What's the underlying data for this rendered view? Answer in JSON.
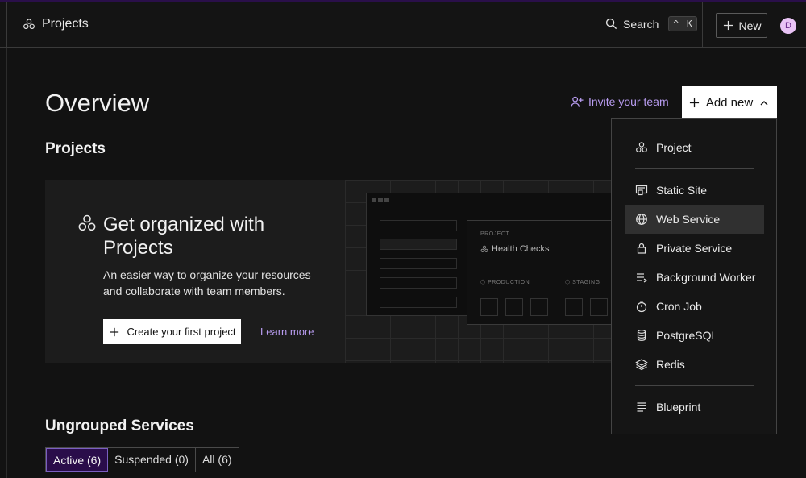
{
  "header": {
    "breadcrumb": "Projects",
    "search_label": "Search",
    "shortcut_modifier": "^",
    "shortcut_key": "K",
    "new_label": "New",
    "avatar_initial": "D"
  },
  "main": {
    "title": "Overview",
    "invite_label": "Invite your team",
    "add_new_label": "Add new",
    "projects_heading": "Projects",
    "promo": {
      "title": "Get organized with Projects",
      "description": "An easier way to organize your resources and collaborate with team members.",
      "create_label": "Create your first project",
      "learn_more_label": "Learn more",
      "mock": {
        "project_label": "PROJECT",
        "project_name": "Health Checks",
        "env_production": "PRODUCTION",
        "env_staging": "STAGING"
      }
    },
    "ungrouped_heading": "Ungrouped Services",
    "tabs": [
      {
        "label": "Active (6)",
        "active": true
      },
      {
        "label": "Suspended (0)",
        "active": false
      },
      {
        "label": "All (6)",
        "active": false
      }
    ]
  },
  "dropdown": {
    "items": [
      {
        "label": "Project",
        "icon": "project-icon"
      },
      {
        "label": "Static Site",
        "icon": "static-site-icon"
      },
      {
        "label": "Web Service",
        "icon": "globe-icon",
        "highlighted": true
      },
      {
        "label": "Private Service",
        "icon": "lock-icon"
      },
      {
        "label": "Background Worker",
        "icon": "worker-icon"
      },
      {
        "label": "Cron Job",
        "icon": "timer-icon"
      },
      {
        "label": "PostgreSQL",
        "icon": "database-icon"
      },
      {
        "label": "Redis",
        "icon": "layers-icon"
      },
      {
        "label": "Blueprint",
        "icon": "blueprint-icon"
      }
    ]
  },
  "colors": {
    "accent_link": "#b89cf0",
    "active_tab_bg": "#2a0d4a",
    "background": "#121212"
  }
}
